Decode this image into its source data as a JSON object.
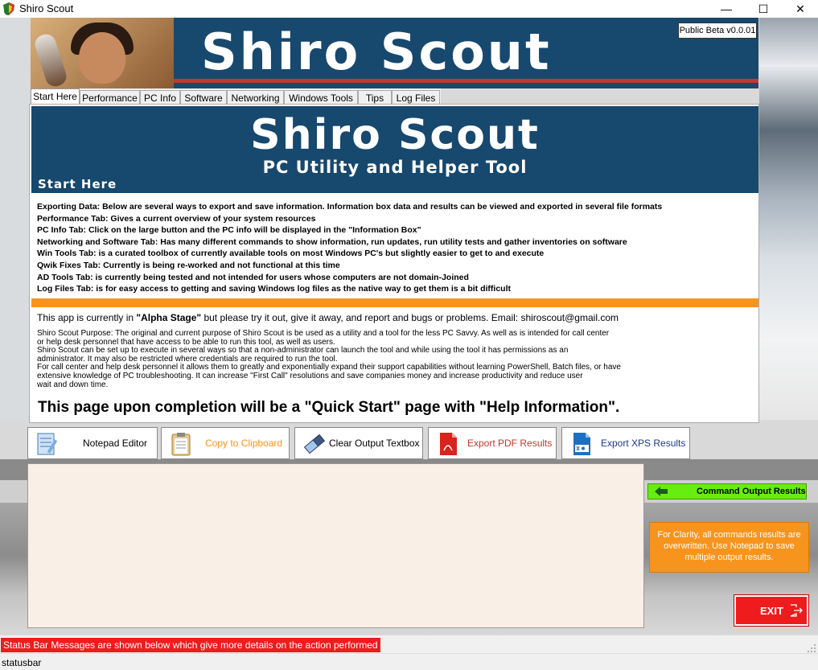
{
  "window": {
    "title": "Shiro Scout",
    "minimize": "—",
    "maximize": "☐",
    "close": "✕"
  },
  "header": {
    "banner_title": "Shiro Scout",
    "version": "Public Beta v0.0.01"
  },
  "tabs": [
    {
      "label": "Start Here",
      "active": true
    },
    {
      "label": "Performance"
    },
    {
      "label": "PC Info"
    },
    {
      "label": "Software"
    },
    {
      "label": "Networking"
    },
    {
      "label": "Windows Tools"
    },
    {
      "label": "Tips"
    },
    {
      "label": "Log Files"
    }
  ],
  "start_page": {
    "title": "Shiro Scout",
    "subtitle": "PC Utility and Helper Tool",
    "section_label": "Start Here",
    "info_lines": [
      "Exporting Data: Below are several ways to export and save information. Information box data and results can be viewed and exported in several file formats",
      "Performance Tab: Gives a current overview of your system resources",
      "PC Info Tab: Click on the large button and the PC info will be displayed in the \"Information Box\"",
      "Networking and Software Tab: Has many different commands to show information, run updates, run utility tests and gather inventories on software",
      "Win Tools Tab: is a curated toolbox of currently available tools on most Windows PC's but slightly easier to get to and execute",
      "Qwik Fixes Tab: Currently is being re-worked and not functional at this time",
      "AD Tools Tab: is currently being tested and not intended for users whose computers are not domain-Joined",
      "Log Files Tab: is for easy access to getting and saving Windows log files as the native way to get them is a bit difficult"
    ],
    "alpha_prefix": "This app is currently in ",
    "alpha_stage": "\"Alpha Stage\"",
    "alpha_suffix": " but please try it out, give it away, and report and bugs or problems. Email: shiroscout@gmail.com",
    "purpose_lines": [
      "Shiro Scout Purpose: The original and current purpose of Shiro Scout is be used as a utility and a tool for the less PC Savvy. As well as is intended for call center",
      "or help desk personnel that have access to be able to run this tool, as well as users.",
      "Shiro Scout can be set up to execute in several ways so that a non-administrator can launch the tool and while using the tool it has permissions as an",
      "administrator. It may also be restricted where credentials are required to run the tool.",
      "For call center and help desk personnel it allows them to greatly and exponentially expand their support capabilities without learning PowerShell, Batch files, or have",
      "extensive knowledge of PC troubleshooting. It can increase \"First Call\" resolutions and save companies money and increase productivity and reduce user",
      "wait and down time."
    ],
    "quick_start": "This page upon completion will be a \"Quick Start\" page with \"Help Information\"."
  },
  "toolbar": {
    "notepad": "Notepad Editor",
    "clipboard": "Copy to Clipboard",
    "clear": "Clear Output Textbox",
    "pdf": "Export PDF Results",
    "xps": "Export XPS Results"
  },
  "output": {
    "text": "",
    "label": "Command Output Results",
    "clarity_note": "For Clarity, all commands results are overwritten. Use Notepad to save multiple output results."
  },
  "exit_label": "EXIT",
  "status": {
    "message": "Status Bar Messages are shown below which give more details on the action performed",
    "statusbar": "statusbar"
  },
  "colors": {
    "banner_blue": "#17486e",
    "accent_orange": "#f7941d",
    "exit_red": "#ee1c1c",
    "output_green": "#66ee11"
  }
}
